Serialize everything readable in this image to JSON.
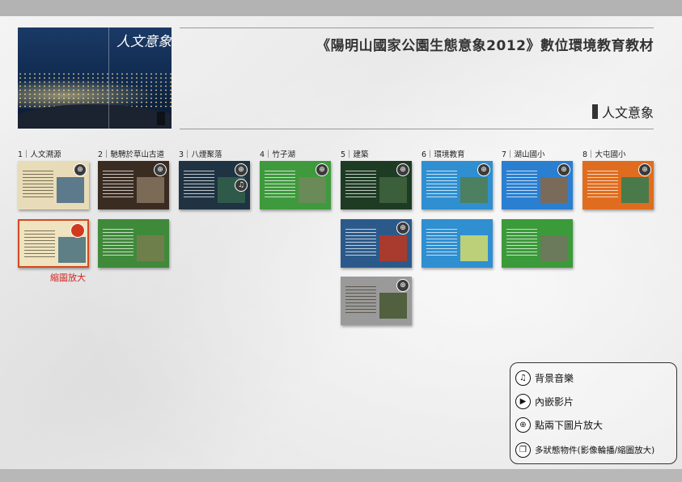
{
  "header": {
    "title": "《陽明山國家公園生態意象2012》數位環境教育教材",
    "section": "人文意象"
  },
  "cover": {
    "title": "人文意象"
  },
  "columns": [
    {
      "heading": "1｜人文溯源",
      "thumbs": [
        {
          "bg": "#e8dcb8",
          "photo": "#5d7a8c",
          "icon": "zoom-icon",
          "text": "dark"
        },
        {
          "bg": "#efe3c0",
          "photo": "#5e7f86",
          "icon": "multi-state-icon",
          "text": "dark",
          "selected": true
        }
      ]
    },
    {
      "heading": "2｜馳騁於草山古道",
      "thumbs": [
        {
          "bg": "#3b2c22",
          "photo": "#7b6a55",
          "icon": "zoom-icon",
          "text": "light"
        },
        {
          "bg": "#3f8a3a",
          "photo": "#6f7f4c",
          "icon": "",
          "text": "light"
        }
      ]
    },
    {
      "heading": "3｜八煙聚落",
      "thumbs": [
        {
          "bg": "#1f3343",
          "photo": "#2f5a4a",
          "icon": "zoom-icon",
          "music": true,
          "text": "light"
        }
      ]
    },
    {
      "heading": "4｜竹子湖",
      "thumbs": [
        {
          "bg": "#3e9a3c",
          "photo": "#6a8a58",
          "icon": "zoom-icon",
          "text": "light"
        }
      ]
    },
    {
      "heading": "5｜建築",
      "thumbs": [
        {
          "bg": "#1e3b24",
          "photo": "#3a5f3a",
          "icon": "zoom-icon",
          "text": "light"
        },
        {
          "bg": "#2b5a8a",
          "photo": "#a83a2e",
          "icon": "zoom-icon",
          "text": "light"
        },
        {
          "bg": "#9a9a9a",
          "photo": "#51603e",
          "icon": "zoom-icon",
          "text": "dark"
        }
      ]
    },
    {
      "heading": "6｜環境教育",
      "thumbs": [
        {
          "bg": "#2f8fd0",
          "photo": "#4c8060",
          "icon": "zoom-icon",
          "text": "light"
        },
        {
          "bg": "#2f8fd0",
          "photo": "#bcd07a",
          "icon": "",
          "text": "light"
        }
      ]
    },
    {
      "heading": "7｜湖山國小",
      "thumbs": [
        {
          "bg": "#2a7fd0",
          "photo": "#7a6a5a",
          "icon": "zoom-icon",
          "text": "light"
        },
        {
          "bg": "#3b9a3a",
          "photo": "#6a7a5a",
          "icon": "",
          "text": "light"
        }
      ]
    },
    {
      "heading": "8｜大屯國小",
      "thumbs": [
        {
          "bg": "#e06d1f",
          "photo": "#4a7a4a",
          "icon": "zoom-icon",
          "text": "light"
        }
      ]
    }
  ],
  "selected_caption": "縮圖放大",
  "legend": [
    {
      "icon": "music-note-icon",
      "glyph": "♫",
      "label": "背景音樂"
    },
    {
      "icon": "play-icon",
      "glyph": "▶",
      "label": "內嵌影片"
    },
    {
      "icon": "zoom-icon",
      "glyph": "⊕",
      "label": "點兩下圖片放大"
    },
    {
      "icon": "multi-state-icon",
      "glyph": "❐",
      "label": "多狀態物件(影像輪播/縮圖放大)"
    }
  ]
}
